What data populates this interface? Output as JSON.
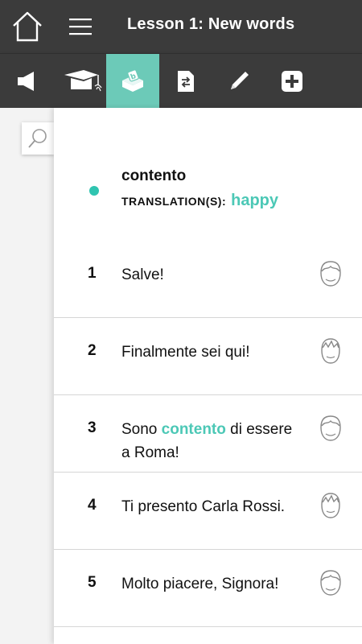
{
  "header": {
    "title": "Lesson 1: New words",
    "home_icon": "home-icon",
    "menu_icon": "hamburger-menu-icon"
  },
  "toolbar": {
    "tools": [
      {
        "name": "speaker-icon",
        "active": false
      },
      {
        "name": "graduation-cap-icon",
        "active": false
      },
      {
        "name": "vocabulary-box-icon",
        "active": true
      },
      {
        "name": "document-swap-icon",
        "active": false
      },
      {
        "name": "pen-icon",
        "active": false
      },
      {
        "name": "plus-icon",
        "active": false
      }
    ],
    "accent_color": "#6ccab8"
  },
  "search": {
    "icon": "search-icon"
  },
  "word": {
    "term": "contento",
    "translation_label": "TRANSLATION(S):",
    "translation": "happy",
    "dot_color": "#2fc4b0"
  },
  "sentences": [
    {
      "num": "1",
      "before": "Salve!",
      "highlight": "",
      "after": "",
      "speaker_icon": "female-face-icon"
    },
    {
      "num": "2",
      "before": "Finalmente sei qui!",
      "highlight": "",
      "after": "",
      "speaker_icon": "male-face-icon"
    },
    {
      "num": "3",
      "before": "Sono ",
      "highlight": "contento",
      "after": " di essere a Roma!",
      "speaker_icon": "female-face-icon"
    },
    {
      "num": "4",
      "before": "Ti presento Carla Rossi.",
      "highlight": "",
      "after": "",
      "speaker_icon": "male-face-icon"
    },
    {
      "num": "5",
      "before": "Molto piacere, Signora!",
      "highlight": "",
      "after": "",
      "speaker_icon": "female-face-icon"
    }
  ]
}
